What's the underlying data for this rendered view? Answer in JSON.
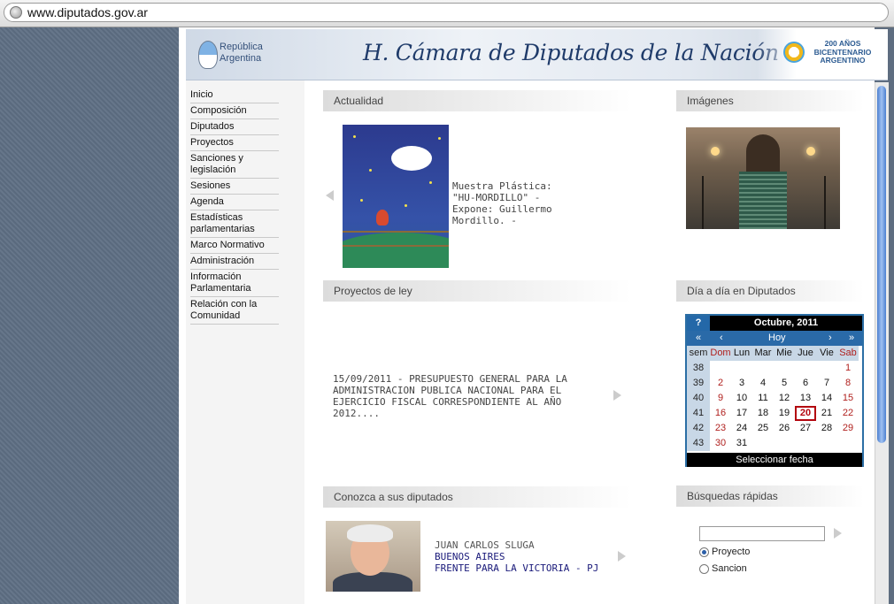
{
  "browser": {
    "url": "www.diputados.gov.ar"
  },
  "banner": {
    "republica_line1": "República",
    "republica_line2": "Argentina",
    "title": "H. Cámara de Diputados de la Nación",
    "bicentenario_line1": "200 AÑOS",
    "bicentenario_line2": "BICENTENARIO",
    "bicentenario_line3": "ARGENTINO"
  },
  "nav": {
    "items": [
      {
        "label": "Inicio"
      },
      {
        "label": "Composición"
      },
      {
        "label": "Diputados"
      },
      {
        "label": "Proyectos"
      },
      {
        "label": "Sanciones y legislación"
      },
      {
        "label": "Sesiones"
      },
      {
        "label": "Agenda"
      },
      {
        "label": "Estadísticas parlamentarias"
      },
      {
        "label": "Marco Normativo"
      },
      {
        "label": "Administración"
      },
      {
        "label": "Información Parlamentaria"
      },
      {
        "label": "Relación con la Comunidad"
      }
    ]
  },
  "sections": {
    "actualidad": {
      "title": "Actualidad",
      "caption": "Muestra Plástica: \"HU-MORDILLO\" - Expone: Guillermo Mordillo. -"
    },
    "imagenes": {
      "title": "Imágenes"
    },
    "proyectos": {
      "title": "Proyectos de ley",
      "text": "15/09/2011 - PRESUPUESTO GENERAL PARA LA ADMINISTRACION PUBLICA NACIONAL PARA EL EJERCICIO FISCAL CORRESPONDIENTE AL AÑO 2012...."
    },
    "dia_a_dia": {
      "title": "Día a día en Diputados"
    },
    "conozca": {
      "title": "Conozca a sus diputados",
      "name": "JUAN CARLOS SLUGA",
      "province": "BUENOS AIRES",
      "party": "FRENTE PARA LA VICTORIA - PJ"
    },
    "busquedas": {
      "title": "Búsquedas rápidas",
      "input_value": "",
      "options": [
        "Proyecto",
        "Sancion"
      ],
      "selected": "Proyecto"
    }
  },
  "calendar": {
    "help": "?",
    "month": "Octubre, 2011",
    "nav": {
      "prev_year": "«",
      "prev_month": "‹",
      "today": "Hoy",
      "next_month": "›",
      "next_year": "»"
    },
    "headers": [
      "sem",
      "Dom",
      "Lun",
      "Mar",
      "Mie",
      "Jue",
      "Vie",
      "Sab"
    ],
    "weeks": [
      {
        "sem": "38",
        "days": [
          "",
          "",
          "",
          "",
          "",
          "",
          "1"
        ]
      },
      {
        "sem": "39",
        "days": [
          "2",
          "3",
          "4",
          "5",
          "6",
          "7",
          "8"
        ]
      },
      {
        "sem": "40",
        "days": [
          "9",
          "10",
          "11",
          "12",
          "13",
          "14",
          "15"
        ]
      },
      {
        "sem": "41",
        "days": [
          "16",
          "17",
          "18",
          "19",
          "20",
          "21",
          "22"
        ]
      },
      {
        "sem": "42",
        "days": [
          "23",
          "24",
          "25",
          "26",
          "27",
          "28",
          "29"
        ]
      },
      {
        "sem": "43",
        "days": [
          "30",
          "31",
          "",
          "",
          "",
          "",
          ""
        ]
      }
    ],
    "today": "20",
    "footer": "Seleccionar fecha"
  },
  "colors": {
    "accent": "#2468a8",
    "today": "#b3060f",
    "weekend": "#b0201e",
    "party": "#1a1a7a"
  }
}
